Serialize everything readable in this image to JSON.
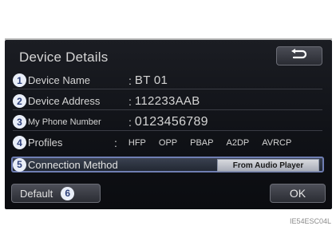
{
  "screen": {
    "title": "Device Details",
    "back_icon": "return-arrow-icon"
  },
  "rows": [
    {
      "number": "1",
      "label": "Device Name",
      "separator": ":",
      "value": "BT 01"
    },
    {
      "number": "2",
      "label": "Device Address",
      "separator": ":",
      "value": "112233AAB"
    },
    {
      "number": "3",
      "label": "My Phone Number",
      "separator": ":",
      "value": "0123456789"
    },
    {
      "number": "4",
      "label": "Profiles",
      "separator": ":",
      "profiles": [
        "HFP",
        "OPP",
        "PBAP",
        "A2DP",
        "AVRCP"
      ]
    }
  ],
  "connection": {
    "number": "5",
    "label": "Connection Method",
    "value": "From Audio Player"
  },
  "buttons": {
    "default_label": "Default",
    "default_number": "6",
    "ok_label": "OK"
  },
  "figure_code": "IE54ESC04L"
}
